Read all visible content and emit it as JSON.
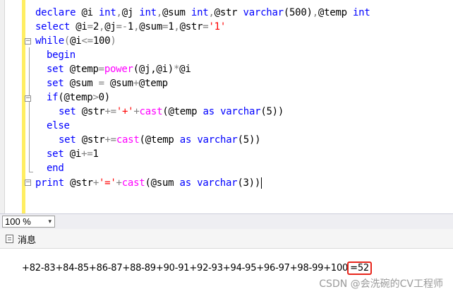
{
  "editor": {
    "lines": {
      "l1": {
        "a": "declare",
        "b": " @i ",
        "c": "int",
        ",1": ",",
        "d": "@j ",
        "e": "int",
        ",2": ",",
        "f": "@sum ",
        "g": "int",
        ",3": ",",
        "h": "@str ",
        "i": "varchar",
        "j": "(500)",
        ",4": ",",
        "k": "@temp ",
        "l": "int"
      },
      "l2": {
        "a": "select",
        "b": " @i",
        "c": "=",
        "d": "2",
        ",1": ",",
        "e": "@j",
        "f": "=",
        "g": "-",
        "h": "1",
        ",2": ",",
        "i": "@sum",
        "j": "=",
        "k": "1",
        ",3": ",",
        "l": "@str",
        "m": "=",
        "n": "'1'"
      },
      "l3": {
        "a": "while",
        "b": "(",
        "c": "@i",
        "d": "<=",
        "e": "100",
        "f": ")"
      },
      "l4": {
        "a": "begin"
      },
      "l5": {
        "a": "set",
        "b": " @temp",
        "c": "=",
        "d": "power",
        "e": "(@j,@i)",
        "f": "*",
        "g": "@i"
      },
      "l6": {
        "a": "set",
        "b": " @sum ",
        "c": "=",
        "d": " @sum",
        "e": "+",
        "f": "@temp"
      },
      "l7": {
        "a": "if",
        "b": "(@temp",
        "c": ">",
        "d": "0)"
      },
      "l8": {
        "a": "set",
        "b": " @str",
        "c": "+=",
        "d": "'+'",
        "e": "+",
        "f": "cast",
        "g": "(@temp ",
        "h": "as",
        "i": " varchar",
        "j": "(5))"
      },
      "l9": {
        "a": "else"
      },
      "l10": {
        "a": "set",
        "b": " @str",
        "c": "+=",
        "d": "cast",
        "e": "(@temp ",
        "f": "as",
        "g": " varchar",
        "h": "(5))"
      },
      "l11": {
        "a": "set",
        "b": " @i",
        "c": "+=",
        "d": "1"
      },
      "l12": {
        "a": "end"
      },
      "l13": {
        "a": "print",
        "b": " @str",
        "c": "+",
        "d": "'='",
        "e": "+",
        "f": "cast",
        "g": "(@sum ",
        "h": "as",
        "i": " varchar",
        "j": "(3))"
      }
    }
  },
  "statusbar": {
    "zoom_value": "100 %",
    "dropdown_arrow": "▾"
  },
  "results_tabs": {
    "messages_label": "消息"
  },
  "messages": {
    "output_sequence": "+82-83+84-85+86-87+88-89+90-91+92-93+94-95+96-97+98-99+100",
    "output_total": "=52"
  },
  "watermark": {
    "text": "CSDN @会洗碗的CV工程师"
  },
  "colors": {
    "keyword": "#0000ff",
    "function": "#ff00ff",
    "string": "#ff0000",
    "operator": "#808080",
    "highlight_box": "#e8261c",
    "yellow_margin": "#ffee62"
  }
}
